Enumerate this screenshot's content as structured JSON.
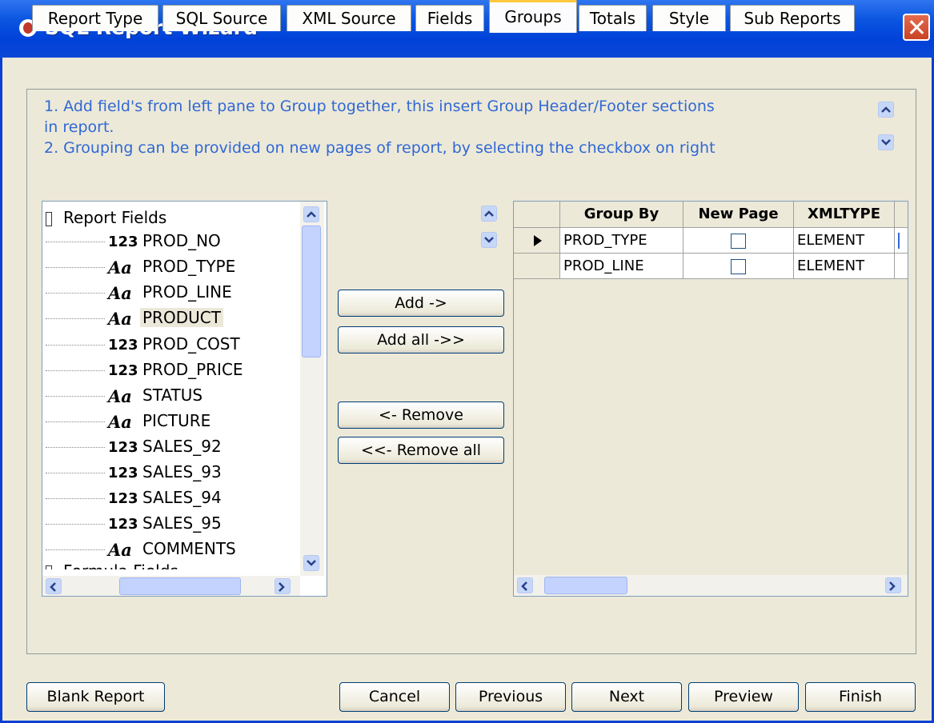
{
  "window": {
    "title": "SQL Report Wizard"
  },
  "tabs": [
    {
      "label": "Report Type"
    },
    {
      "label": "SQL Source"
    },
    {
      "label": "XML Source"
    },
    {
      "label": "Fields"
    },
    {
      "label": "Groups"
    },
    {
      "label": "Totals"
    },
    {
      "label": "Style"
    },
    {
      "label": "Sub Reports"
    }
  ],
  "active_tab": "Groups",
  "instructions": {
    "line1": "1. Add field's from left pane to Group together, this insert Group Header/Footer sections",
    "line2": "in report.",
    "line3": "2. Grouping can be provided on new pages of report, by selecting the checkbox on right"
  },
  "tree": {
    "root_label": "Report Fields",
    "items": [
      {
        "type_icon": "123",
        "label": "PROD_NO"
      },
      {
        "type_icon": "Aa",
        "label": "PROD_TYPE"
      },
      {
        "type_icon": "Aa",
        "label": "PROD_LINE"
      },
      {
        "type_icon": "Aa",
        "label": "PRODUCT"
      },
      {
        "type_icon": "123",
        "label": "PROD_COST"
      },
      {
        "type_icon": "123",
        "label": "PROD_PRICE"
      },
      {
        "type_icon": "Aa",
        "label": "STATUS"
      },
      {
        "type_icon": "Aa",
        "label": "PICTURE"
      },
      {
        "type_icon": "123",
        "label": "SALES_92"
      },
      {
        "type_icon": "123",
        "label": "SALES_93"
      },
      {
        "type_icon": "123",
        "label": "SALES_94"
      },
      {
        "type_icon": "123",
        "label": "SALES_95"
      },
      {
        "type_icon": "Aa",
        "label": "COMMENTS"
      }
    ],
    "second_root_label": "Formula Fields",
    "selected_item": "PRODUCT"
  },
  "actions": {
    "add": "Add ->",
    "add_all": "Add all ->>",
    "remove": "<- Remove",
    "remove_all": "<<- Remove all"
  },
  "grid": {
    "columns": [
      "Group By",
      "New Page",
      "XMLTYPE"
    ],
    "rows": [
      {
        "group_by": "PROD_TYPE",
        "new_page": false,
        "xmltype": "ELEMENT",
        "current": true
      },
      {
        "group_by": "PROD_LINE",
        "new_page": false,
        "xmltype": "ELEMENT",
        "current": false
      }
    ]
  },
  "footer": {
    "blank_report": "Blank Report",
    "cancel": "Cancel",
    "previous": "Previous",
    "next": "Next",
    "preview": "Preview",
    "finish": "Finish"
  },
  "colors": {
    "titlebar": "#0a55e0",
    "instruction_text": "#3168d5",
    "active_tab_accent": "#ffc83c"
  }
}
